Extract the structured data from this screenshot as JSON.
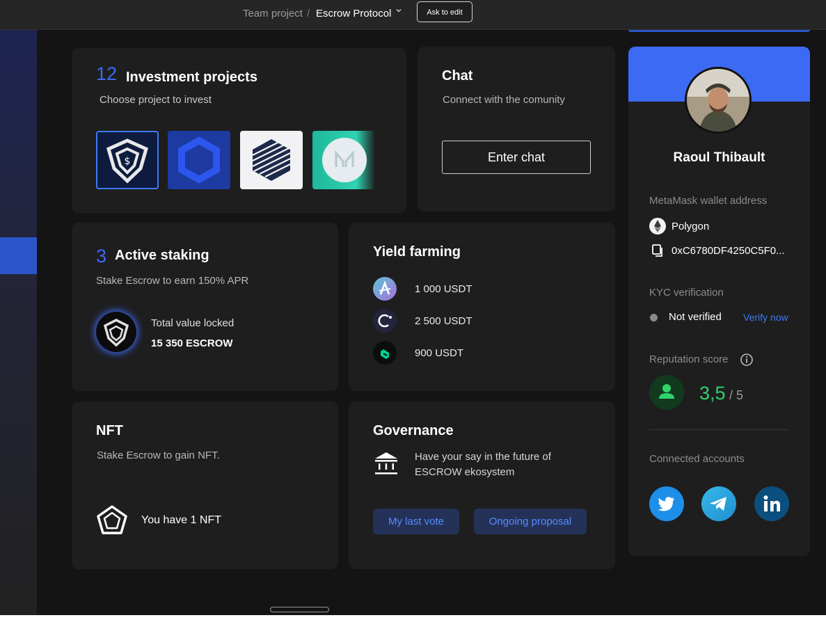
{
  "topbar": {
    "team": "Team project",
    "separator": "/",
    "project": "Escrow Protocol",
    "ask_to_edit": "Ask to edit"
  },
  "investment": {
    "count": "12",
    "title": "Investment projects",
    "subtitle": "Choose project to invest",
    "tiles": [
      "escrow-logo-tile",
      "chainlink-logo-tile",
      "cube-logo-tile",
      "maker-logo-tile"
    ]
  },
  "chat": {
    "title": "Chat",
    "subtitle": "Connect with the comunity",
    "button": "Enter chat"
  },
  "staking": {
    "count": "3",
    "title": "Active staking",
    "subtitle": "Stake Escrow to earn 150% APR",
    "tvl_label": "Total value locked",
    "tvl_value": "15 350 ESCROW"
  },
  "yield": {
    "title": "Yield farming",
    "items": [
      {
        "icon": "aave-icon",
        "value": "1 000 USDT"
      },
      {
        "icon": "celo-icon",
        "value": "2 500 USDT"
      },
      {
        "icon": "compound-icon",
        "value": "900 USDT"
      }
    ]
  },
  "nft": {
    "title": "NFT",
    "subtitle": "Stake Escrow to gain NFT.",
    "count_text": "You have 1 NFT"
  },
  "governance": {
    "title": "Governance",
    "text_line1": "Have your say in the future of",
    "text_line2": "ESCROW ekosystem",
    "btn_last_vote": "My last vote",
    "btn_ongoing": "Ongoing proposal"
  },
  "profile": {
    "name": "Raoul Thibault",
    "wallet_label": "MetaMask wallet address",
    "network": "Polygon",
    "address": "0xC6780DF4250C5F0...",
    "kyc_label": "KYC verification",
    "kyc_status": "Not verified",
    "kyc_action": "Verify now",
    "rep_label": "Reputation score",
    "rep_score": "3,5",
    "rep_max": "/ 5",
    "accounts_label": "Connected accounts"
  },
  "colors": {
    "accent": "#3d6af2",
    "score_green": "#2fd36b",
    "link_blue": "#3d7af5"
  }
}
